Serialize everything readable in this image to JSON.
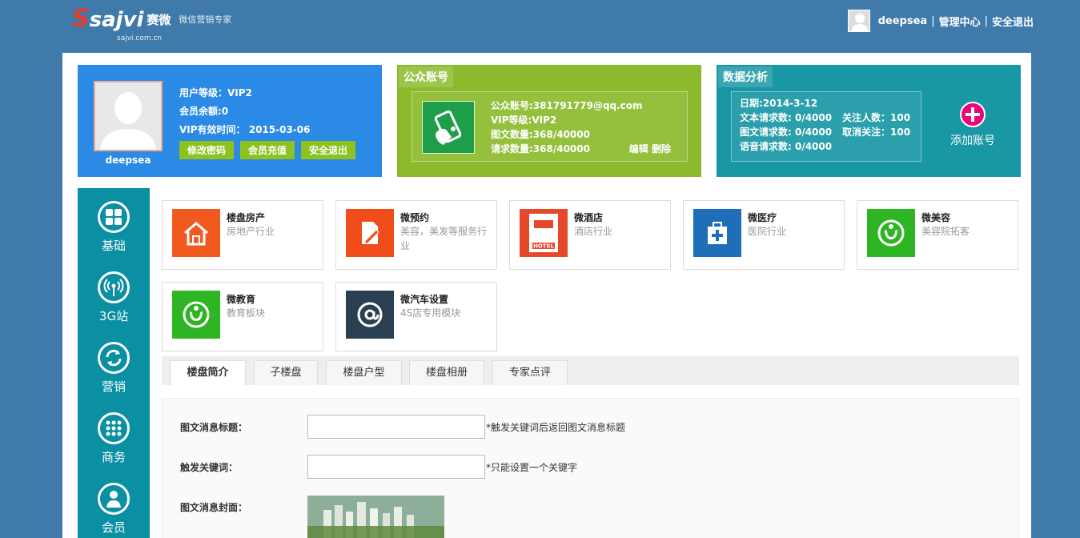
{
  "header": {
    "logo_mark": "sajvi",
    "logo_cn": "赛微",
    "logo_domain": "sajvi.com.cn",
    "slogan": "微信营销专家",
    "username": "deepsea",
    "admin_link": "管理中心",
    "logout_link": "安全退出",
    "sep": "|"
  },
  "profile": {
    "name": "deepsea",
    "level": "用户等级：VIP2",
    "balance": "会员余额:0",
    "expire": "VIP有效时间： 2015-03-06",
    "btn_password": "修改密码",
    "btn_recharge": "会员充值",
    "btn_logout": "安全退出"
  },
  "account": {
    "title": "公众账号",
    "line1": "公众账号:381791779@qq.com",
    "line2": "VIP等级:VIP2",
    "line3": "图文数量:368/40000",
    "line4": "请求数量:368/40000",
    "edit": "编辑",
    "delete": "删除"
  },
  "analytics": {
    "title": "数据分析",
    "date": "日期:2014-3-12",
    "text_req": "文本请求数: 0/4000",
    "follow": "关注人数：100",
    "news_req": "图文请求数: 0/4000",
    "unfollow": "取消关注：100",
    "voice_req": "语音请求数: 0/4000",
    "add_account": "添加账号"
  },
  "sidebar": {
    "items": [
      {
        "label": "基础"
      },
      {
        "label": "3G站"
      },
      {
        "label": "营销"
      },
      {
        "label": "商务"
      },
      {
        "label": "会员"
      }
    ]
  },
  "modules": [
    {
      "name": "楼盘房产",
      "desc": "房地产行业",
      "color": "#f05a1e"
    },
    {
      "name": "微预约",
      "desc": "美容，美发等服务行业",
      "color": "#f04d1a"
    },
    {
      "name": "微酒店",
      "desc": "酒店行业",
      "color": "#e8482a"
    },
    {
      "name": "微医疗",
      "desc": "医院行业",
      "color": "#1f6fb8"
    },
    {
      "name": "微美容",
      "desc": "美容院拓客",
      "color": "#2eb523"
    },
    {
      "name": "微教育",
      "desc": "教育板块",
      "color": "#2eb523"
    },
    {
      "name": "微汽车设置",
      "desc": "4S店专用模块",
      "color": "#2a3f52"
    }
  ],
  "hotel_sign": "HOTEL",
  "tabs": [
    {
      "label": "楼盘简介"
    },
    {
      "label": "子楼盘"
    },
    {
      "label": "楼盘户型"
    },
    {
      "label": "楼盘相册"
    },
    {
      "label": "专家点评"
    }
  ],
  "form": {
    "title_label": "图文消息标题：",
    "title_value": "",
    "title_hint": "*触发关键词后返回图文消息标题",
    "keyword_label": "触发关键词：",
    "keyword_value": "",
    "keyword_hint": "*只能设置一个关键字",
    "cover_label": "图文消息封面："
  }
}
